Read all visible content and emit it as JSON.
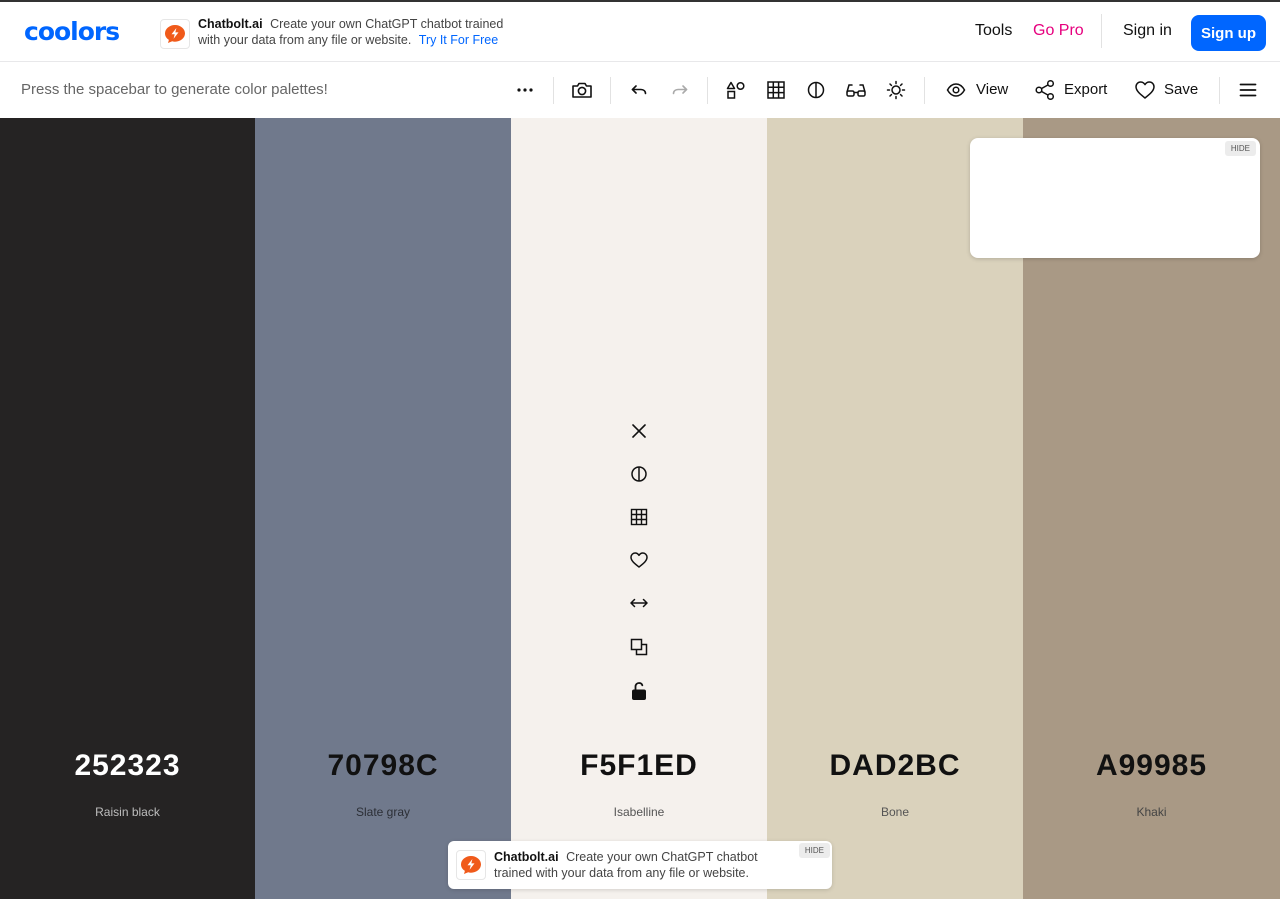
{
  "brand": {
    "logo_text": "coolors"
  },
  "ad_top": {
    "brand": "Chatbolt.ai",
    "text": "Create your own ChatGPT chatbot trained with your data from any file or website.",
    "cta": "Try It For Free"
  },
  "nav": {
    "tools": "Tools",
    "go_pro": "Go Pro",
    "sign_in": "Sign in",
    "sign_up": "Sign up"
  },
  "toolbar": {
    "hint": "Press the spacebar to generate color palettes!",
    "view_label": "View",
    "export_label": "Export",
    "save_label": "Save"
  },
  "palette": [
    {
      "hex": "252323",
      "name": "Raisin black",
      "color": "#252323",
      "text_color": "#ffffff",
      "name_color": "#bdbdbd"
    },
    {
      "hex": "70798C",
      "name": "Slate gray",
      "color": "#70798C",
      "text_color": "#111111",
      "name_color": "#2c2f36"
    },
    {
      "hex": "F5F1ED",
      "name": "Isabelline",
      "color": "#F5F1ED",
      "text_color": "#111111",
      "name_color": "#555555"
    },
    {
      "hex": "DAD2BC",
      "name": "Bone",
      "color": "#DAD2BC",
      "text_color": "#111111",
      "name_color": "#555555"
    },
    {
      "hex": "A99985",
      "name": "Khaki",
      "color": "#A99985",
      "text_color": "#111111",
      "name_color": "#444444"
    }
  ],
  "panel": {
    "hide_label": "HIDE"
  },
  "ad_bottom": {
    "brand": "Chatbolt.ai",
    "text": "Create your own ChatGPT chatbot trained with your data from any file or website.",
    "hide_label": "HIDE"
  },
  "colors": {
    "accent": "#0066ff",
    "go_pro": "#e6007e",
    "ad_orange": "#f05a1a"
  },
  "icons": {
    "toolbar": [
      "more-icon",
      "camera-icon",
      "undo-icon",
      "redo-icon",
      "shapes-icon",
      "grid-icon",
      "contrast-icon",
      "glasses-icon",
      "brightness-icon",
      "eye-icon",
      "share-icon",
      "heart-icon",
      "menu-icon"
    ],
    "color_tools": [
      "close-icon",
      "contrast-icon",
      "grid-icon",
      "heart-icon",
      "drag-icon",
      "copy-icon",
      "lock-icon"
    ]
  }
}
